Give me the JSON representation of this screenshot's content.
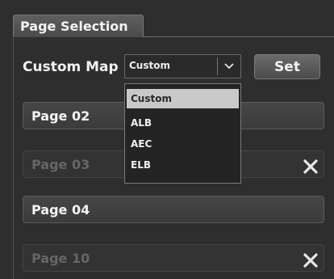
{
  "tab": {
    "label": "Page Selection"
  },
  "custom_map": {
    "label": "Custom Map",
    "selected": "Custom",
    "options": [
      "Custom",
      "ALB",
      "AEC",
      "ELB"
    ],
    "set_label": "Set"
  },
  "pages": [
    {
      "label": "Page 02",
      "state": "active"
    },
    {
      "label": "Page 03",
      "state": "disabled"
    },
    {
      "label": "Page 04",
      "state": "active"
    },
    {
      "label": "Page 10",
      "state": "disabled"
    }
  ],
  "colors": {
    "background": "#2d2d2d",
    "selected_option": "#c9c9c9"
  }
}
